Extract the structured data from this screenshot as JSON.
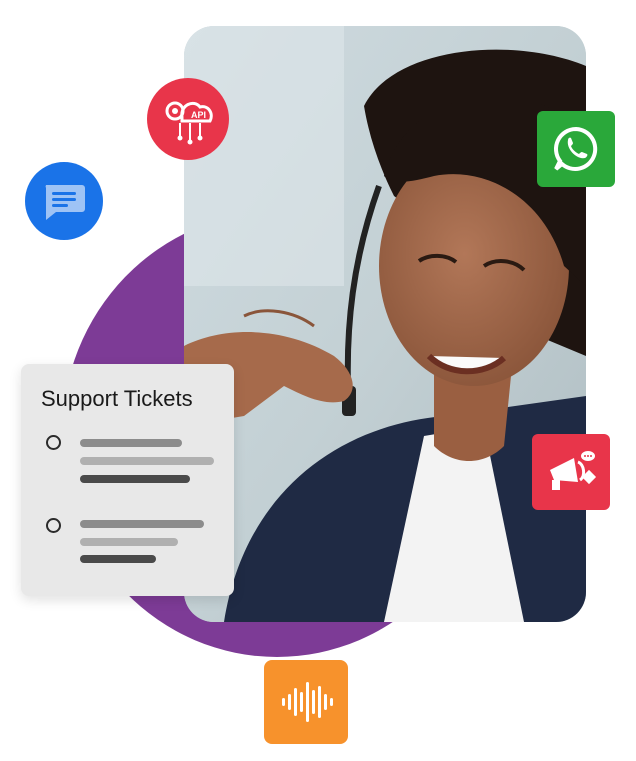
{
  "support_tickets": {
    "title": "Support Tickets",
    "items": [
      {
        "lines": 3
      },
      {
        "lines": 3
      }
    ]
  },
  "icons": {
    "messages": "chat-message-icon",
    "api": "api-gear-cloud-icon",
    "whatsapp": "whatsapp-icon",
    "marketing": "megaphone-icon",
    "voice": "sound-wave-icon"
  },
  "colors": {
    "purple": "#7d3b96",
    "messages_blue": "#1a73e8",
    "api_red": "#e8354a",
    "whatsapp_green": "#2aa83a",
    "marketing_red": "#e8354a",
    "voice_orange": "#f7922c"
  }
}
